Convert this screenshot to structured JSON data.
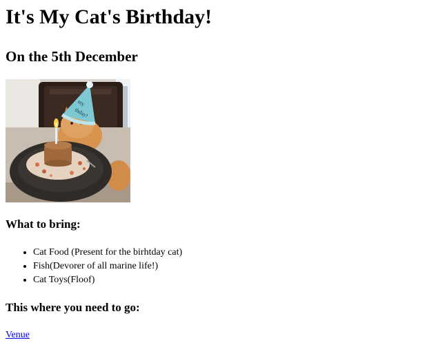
{
  "title": "It's My Cat's Birthday!",
  "subtitle": "On the 5th December",
  "photo": {
    "hat_text_1": "my",
    "hat_text_2": "thday!",
    "colors": {
      "hat": "#7ec8d3",
      "pompom": "#e9f5f7",
      "cat": "#d8934f",
      "plate": "#2f2b28",
      "cake": "#a06a3e",
      "flame": "#ffcf4a",
      "table": "#c4b6a7"
    }
  },
  "bring": {
    "heading": "What to bring:",
    "items": [
      "Cat Food (Present for the birhtday cat)",
      "Fish(Devorer of all marine life!)",
      "Cat Toys(Floof)"
    ]
  },
  "go": {
    "heading": "This where you need to go:",
    "link_label": "Venue"
  }
}
